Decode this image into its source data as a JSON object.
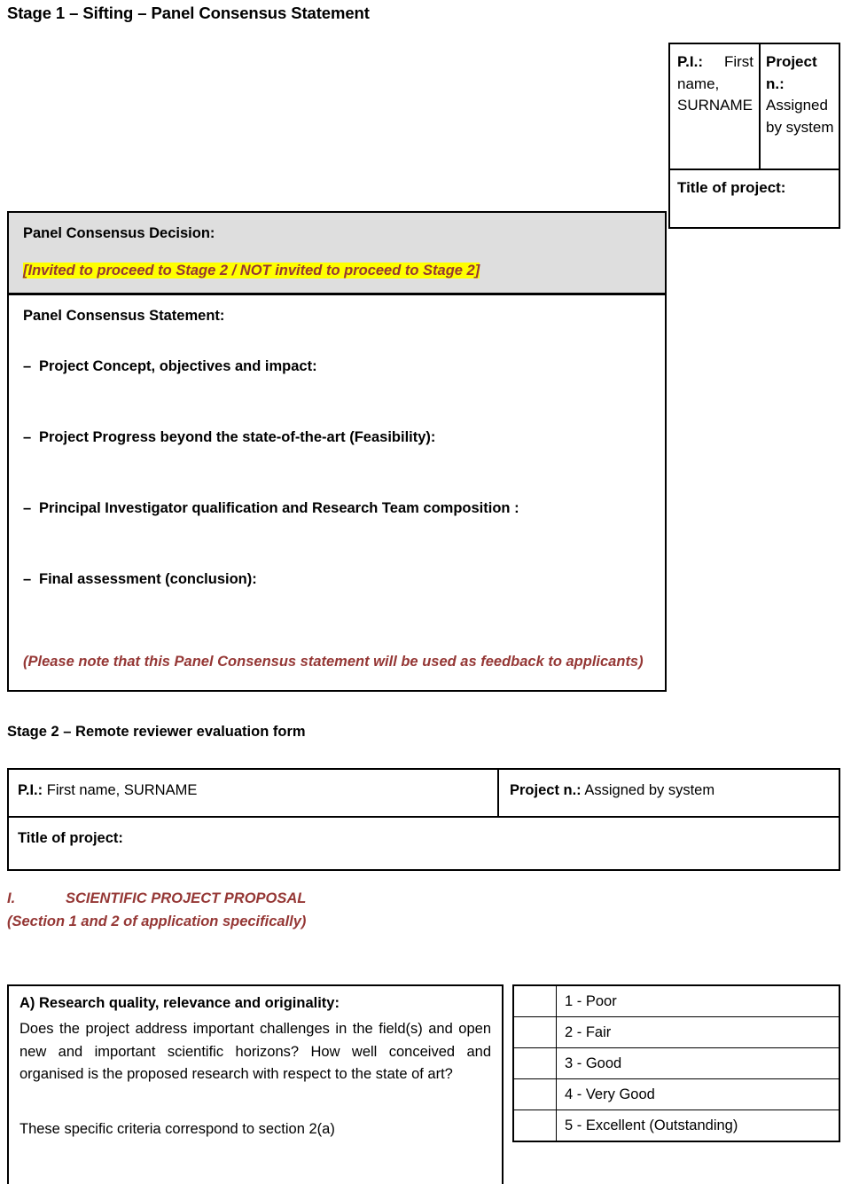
{
  "document": {
    "title": "Stage 1 – Sifting – Panel Consensus Statement"
  },
  "stage1_header_table": {
    "pi_label": "P.I.:",
    "pi_value": "First name, SURNAME",
    "project_label": "Project n.:",
    "project_value": "Assigned by system",
    "title_label": "Title of project:"
  },
  "consensus": {
    "decision_label": "Panel Consensus Decision:",
    "decision_options": "[Invited to proceed to Stage 2 / NOT invited to proceed to Stage 2]",
    "statement_label": "Panel Consensus Statement:",
    "dash": "–",
    "items": [
      "Project Concept, objectives and impact:",
      "Project Progress beyond the state-of-the-art (Feasibility):",
      "Principal Investigator qualification and Research Team composition :",
      "Final assessment (conclusion):"
    ],
    "note": "(Please note that this Panel Consensus statement will be used as feedback to applicants)",
    "decision_bg": "#DEDEDE",
    "highlight_color": "#FFFF00",
    "accent_color": "#953735"
  },
  "stage2": {
    "heading": "Stage 2 – Remote reviewer evaluation form",
    "pi_label": "P.I.:",
    "pi_value": "First name, SURNAME",
    "project_label": "Project n.:",
    "project_value": "Assigned by system",
    "title_label": "Title of project:"
  },
  "proposal_section": {
    "numeral": "I.",
    "title": "SCIENTIFIC PROJECT PROPOSAL",
    "subtitle": "(Section 1 and 2 of application specifically)"
  },
  "criterion_a": {
    "title": "A) Research quality, relevance and originality:",
    "body": "Does the project address important challenges in the field(s) and open new and important scientific horizons? How well conceived and organised is the proposed research with respect to the state of art?",
    "footer": "These specific criteria correspond to section 2(a)"
  },
  "rating_scale": {
    "options": [
      "1 - Poor",
      "2 - Fair",
      "3 - Good",
      "4 - Very Good",
      "5 - Excellent (Outstanding)"
    ]
  }
}
